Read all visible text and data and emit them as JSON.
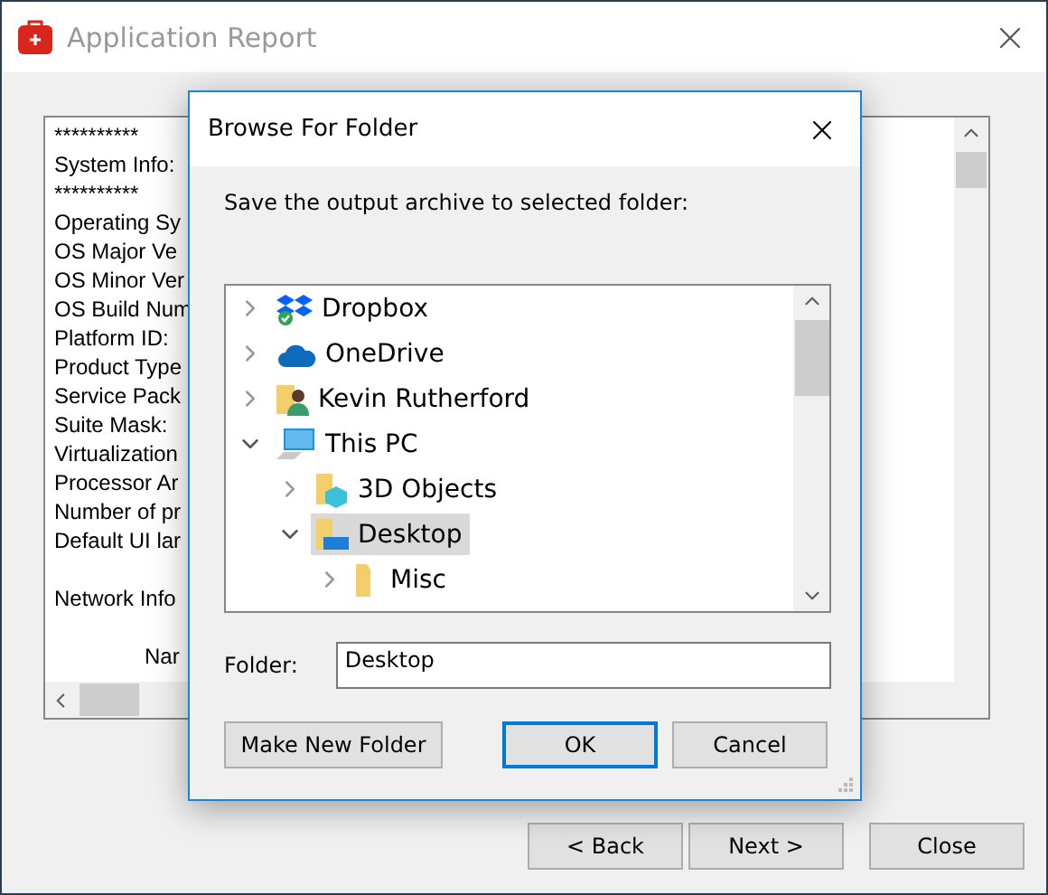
{
  "window": {
    "title": "Application Report"
  },
  "report": {
    "sections": [
      {
        "kind": "plain",
        "lines": [
          "**********",
          "System Info:",
          "**********",
          "Operating Sy",
          "OS Major Ve",
          "OS Minor Ver",
          "OS Build Num",
          "Platform ID:",
          "Product Type",
          "Service Pack",
          "Suite Mask:",
          "Virtualization",
          "Processor Ar",
          "Number of pr",
          "Default UI lar"
        ]
      },
      {
        "kind": "plain",
        "lines": [
          "Network Info"
        ]
      },
      {
        "kind": "column-header",
        "lines": [
          "Nar"
        ]
      }
    ]
  },
  "buttons": [
    {
      "label": "< Back"
    },
    {
      "label": "Next >"
    },
    {
      "label": "Close"
    }
  ],
  "dialog": {
    "title": "Browse For Folder",
    "prompt": "Save the output archive to selected folder:",
    "tree": [
      {
        "label": "Dropbox",
        "kind": "dropbox",
        "expanded": false,
        "selected": false
      },
      {
        "label": "OneDrive",
        "kind": "cloud",
        "expanded": false,
        "selected": false
      },
      {
        "label": "Kevin Rutherford",
        "kind": "user-folder",
        "expanded": false,
        "selected": false
      },
      {
        "label": "This PC",
        "kind": "computer",
        "expanded": true,
        "selected": false,
        "children": [
          {
            "label": "3D Objects",
            "kind": "cube-folder",
            "expanded": false,
            "selected": false
          },
          {
            "label": "Desktop",
            "kind": "desktop-folder",
            "expanded": true,
            "selected": true,
            "children": [
              {
                "label": "Misc",
                "kind": "folder",
                "expanded": false,
                "selected": false
              }
            ]
          }
        ]
      }
    ],
    "folder_label": "Folder:",
    "folder_value": "Desktop",
    "buttons": [
      {
        "label": "Make New Folder",
        "default": false
      },
      {
        "label": "OK",
        "default": true
      },
      {
        "label": "Cancel",
        "default": false
      }
    ]
  }
}
